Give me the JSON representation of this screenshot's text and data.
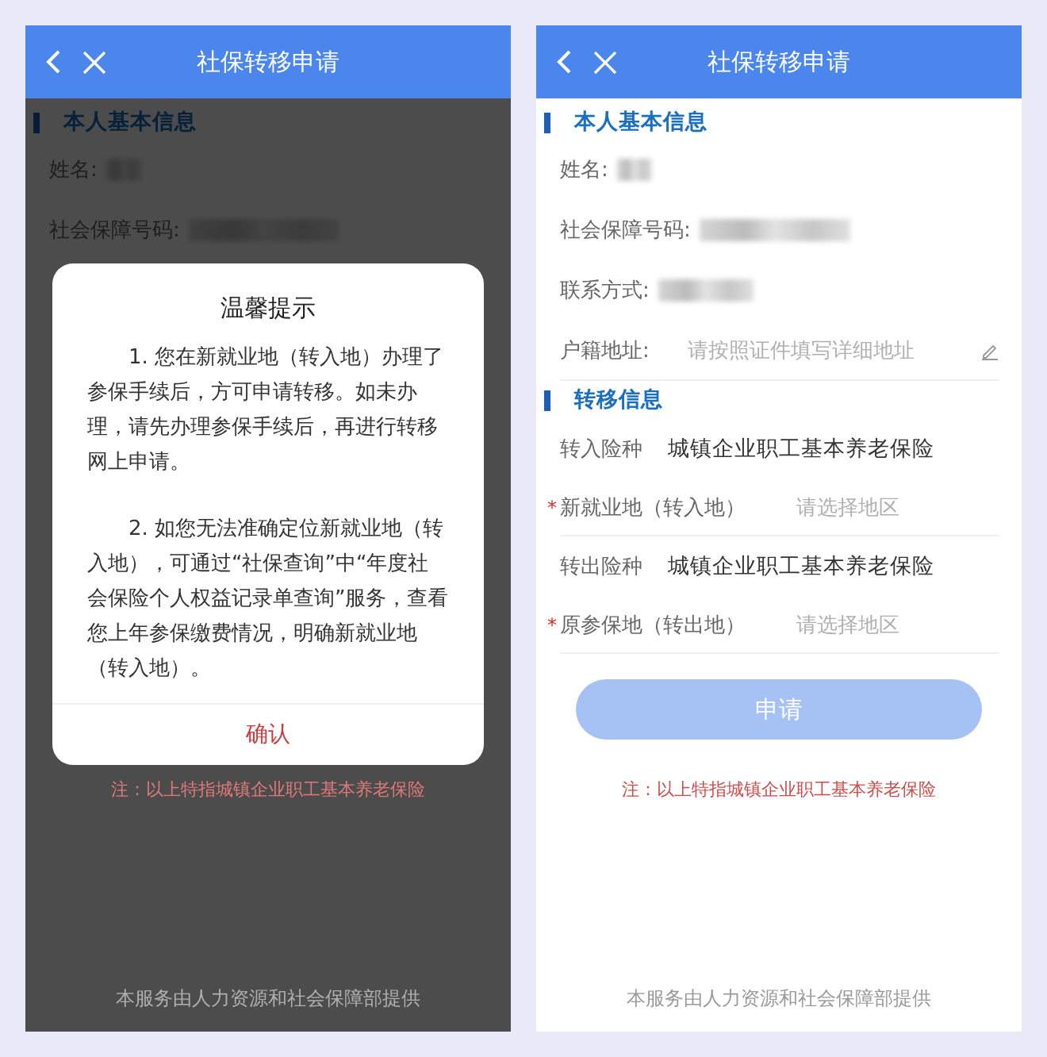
{
  "screens": [
    {
      "header": {
        "title": "社保转移申请"
      },
      "dimmed": true,
      "sections": [
        {
          "title": "本人基本信息",
          "rows": [
            {
              "kind": "info",
              "label": "姓名:",
              "redacted": true
            },
            {
              "kind": "info",
              "label": "社会保障号码:",
              "redacted": true
            }
          ]
        }
      ],
      "note": "注：以上特指城镇企业职工基本养老保险",
      "footer": "本服务由人力资源和社会保障部提供",
      "dialog": {
        "title": "温馨提示",
        "paragraphs": [
          "1. 您在新就业地（转入地）办理了参保手续后，方可申请转移。如未办理，请先办理参保手续后，再进行转移网上申请。",
          "2. 如您无法准确定位新就业地（转入地），可通过“社保查询”中“年度社会保险个人权益记录单查询”服务，查看您上年参保缴费情况，明确新就业地（转入地）。"
        ],
        "confirm": "确认"
      }
    },
    {
      "header": {
        "title": "社保转移申请"
      },
      "dimmed": false,
      "sections": [
        {
          "title": "本人基本信息",
          "rows": [
            {
              "kind": "info",
              "label": "姓名:",
              "redacted": true
            },
            {
              "kind": "info",
              "label": "社会保障号码:",
              "redacted": true
            },
            {
              "kind": "info",
              "label": "联系方式:",
              "redacted": true
            },
            {
              "kind": "input",
              "label": "户籍地址:",
              "placeholder": "请按照证件填写详细地址"
            }
          ]
        },
        {
          "title": "转移信息",
          "rows": [
            {
              "kind": "value",
              "label": "转入险种",
              "value": "城镇企业职工基本养老保险"
            },
            {
              "kind": "select",
              "required_mark": "*",
              "label": "新就业地（转入地）",
              "placeholder": "请选择地区"
            },
            {
              "kind": "value",
              "label": "转出险种",
              "value": "城镇企业职工基本养老保险"
            },
            {
              "kind": "select",
              "required_mark": "*",
              "label": "原参保地（转出地）",
              "placeholder": "请选择地区"
            }
          ]
        }
      ],
      "button": {
        "label": "申请",
        "disabled": true
      },
      "note": "注：以上特指城镇企业职工基本养老保险",
      "footer": "本服务由人力资源和社会保障部提供"
    }
  ]
}
